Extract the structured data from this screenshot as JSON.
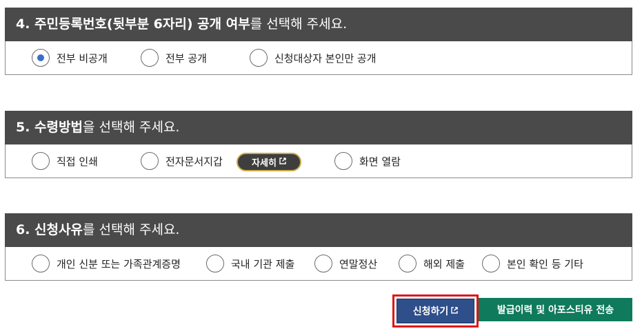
{
  "section4": {
    "title_bold": "4. 주민등록번호(뒷부분 6자리) 공개 여부",
    "title_rest": "를 선택해 주세요.",
    "options": [
      {
        "label": "전부 비공개",
        "checked": true
      },
      {
        "label": "전부 공개",
        "checked": false
      },
      {
        "label": "신청대상자 본인만 공개",
        "checked": false
      }
    ]
  },
  "section5": {
    "title_bold": "5. 수령방법",
    "title_rest": "을 선택해 주세요.",
    "options": [
      {
        "label": "직접 인쇄",
        "checked": false
      },
      {
        "label": "전자문서지갑",
        "checked": false
      },
      {
        "label": "화면 열람",
        "checked": false
      }
    ],
    "detail_label": "자세히"
  },
  "section6": {
    "title_bold": "6. 신청사유",
    "title_rest": "를 선택해 주세요.",
    "options": [
      {
        "label": "개인 신분 또는 가족관계증명",
        "checked": false
      },
      {
        "label": "국내 기관 제출",
        "checked": false
      },
      {
        "label": "연말정산",
        "checked": false
      },
      {
        "label": "해외 제출",
        "checked": false
      },
      {
        "label": "본인 확인 등 기타",
        "checked": false
      }
    ]
  },
  "actions": {
    "apply_label": "신청하기",
    "send_label": "발급이력 및 아포스티유 전송"
  },
  "icons": {
    "external_link": "external-link-icon"
  },
  "colors": {
    "header_bg": "#4a4a4a",
    "radio_checked": "#3a6fc4",
    "apply_bg": "#2f4f8a",
    "send_bg": "#0f7a5c",
    "highlight": "#e01414"
  }
}
